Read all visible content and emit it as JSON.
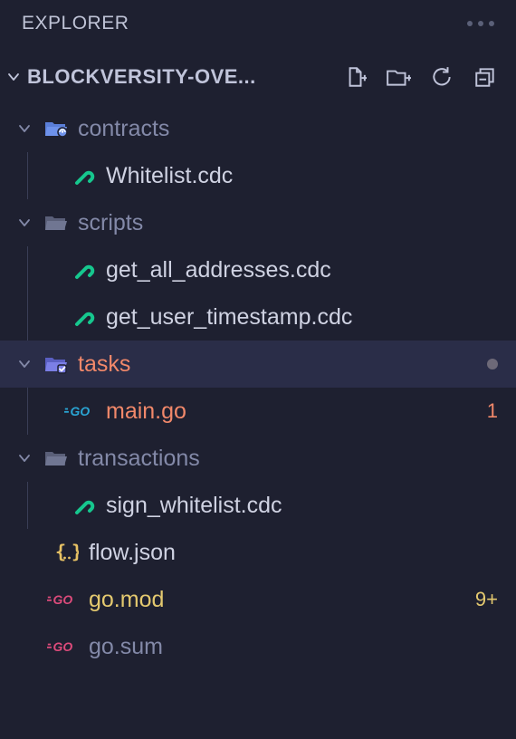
{
  "explorer": {
    "title": "EXPLORER",
    "workspace": "BLOCKVERSITY-OVE..."
  },
  "tree": {
    "contracts": {
      "label": "contracts",
      "whitelist": "Whitelist.cdc"
    },
    "scripts": {
      "label": "scripts",
      "get_all_addresses": "get_all_addresses.cdc",
      "get_user_timestamp": "get_user_timestamp.cdc"
    },
    "tasks": {
      "label": "tasks",
      "main_go": "main.go",
      "main_go_badge": "1"
    },
    "transactions": {
      "label": "transactions",
      "sign_whitelist": "sign_whitelist.cdc"
    },
    "flow_json": "flow.json",
    "go_mod": "go.mod",
    "go_mod_badge": "9+",
    "go_sum": "go.sum"
  }
}
